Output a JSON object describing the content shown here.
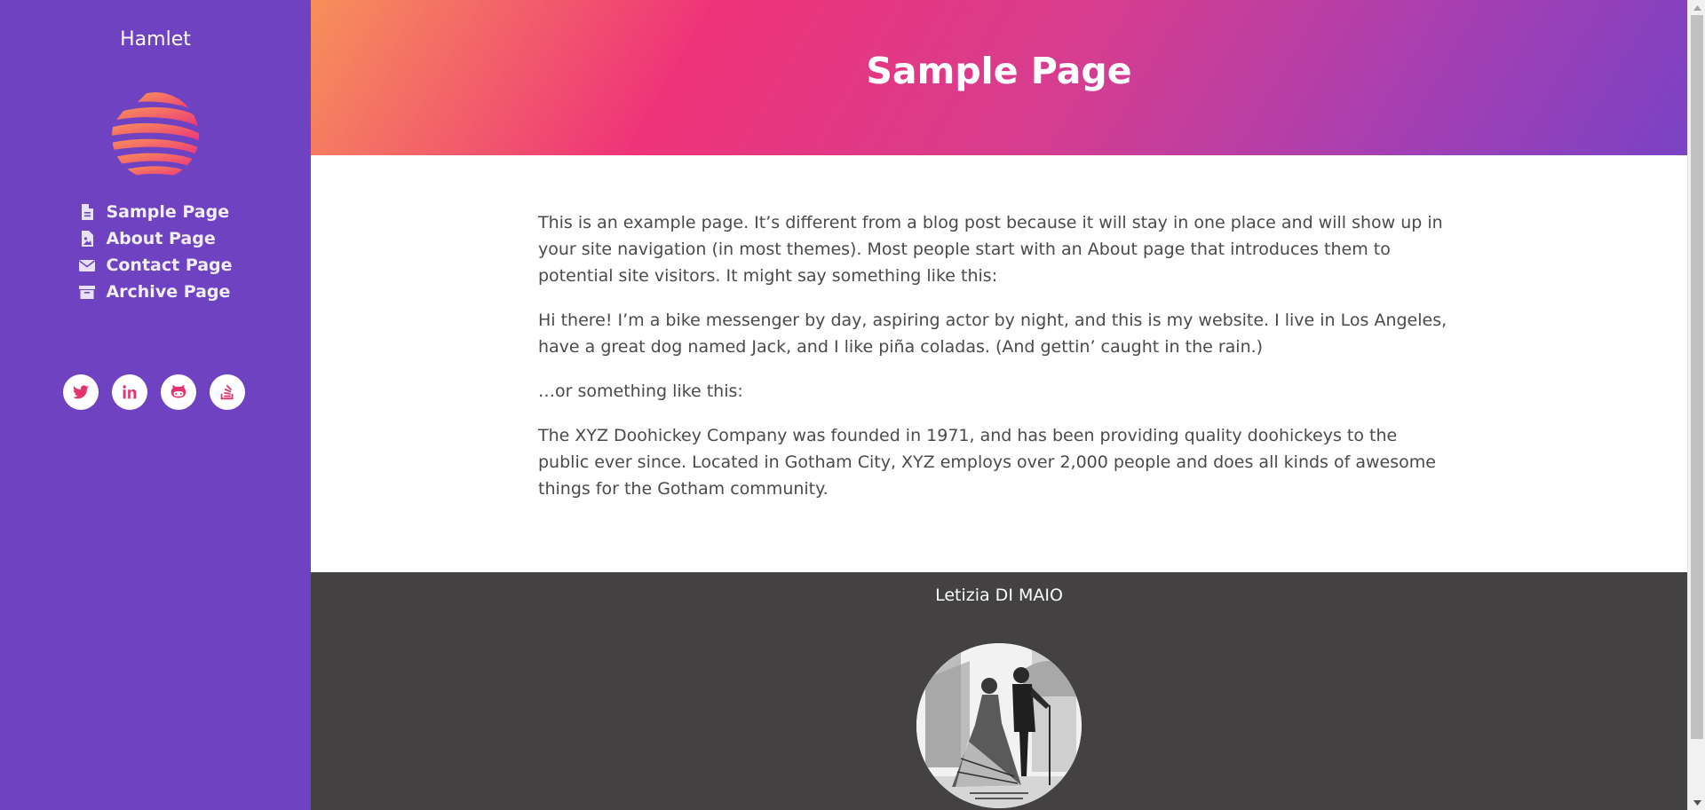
{
  "sidebar": {
    "site_title": "Hamlet",
    "logo_icon": "striped-globe-logo",
    "nav": [
      {
        "label": "Sample Page",
        "icon": "file-icon"
      },
      {
        "label": "About Page",
        "icon": "file-image-icon"
      },
      {
        "label": "Contact Page",
        "icon": "envelope-icon"
      },
      {
        "label": "Archive Page",
        "icon": "archive-box-icon"
      }
    ],
    "social": [
      {
        "icon": "twitter-icon"
      },
      {
        "icon": "linkedin-icon"
      },
      {
        "icon": "github-icon"
      },
      {
        "icon": "stack-overflow-icon"
      }
    ],
    "linkedin_text": "in"
  },
  "header": {
    "title": "Sample Page"
  },
  "content": {
    "paragraphs": [
      "This is an example page. It’s different from a blog post because it will stay in one place and will show up in your site navigation (in most themes). Most people start with an About page that introduces them to potential site visitors. It might say something like this:",
      "Hi there! I’m a bike messenger by day, aspiring actor by night, and this is my website. I live in Los Angeles, have a great dog named Jack, and I like piña coladas. (And gettin’ caught in the rain.)",
      "…or something like this:",
      "The XYZ Doohickey Company was founded in 1971, and has been providing quality doohickeys to the public ever since. Located in Gotham City, XYZ employs over 2,000 people and does all kinds of awesome things for the Gotham community."
    ]
  },
  "footer": {
    "author": "Letizia DI MAIO",
    "avatar": "hamlet-illustration"
  },
  "colors": {
    "sidebar_bg": "#6f42c1",
    "header_gradient_start": "#f7905a",
    "header_gradient_mid": "#ee3379",
    "header_gradient_end": "#7a42c4",
    "social_icon": "#e5336f",
    "footer_bg": "#434142",
    "text": "#4a4a4a"
  }
}
